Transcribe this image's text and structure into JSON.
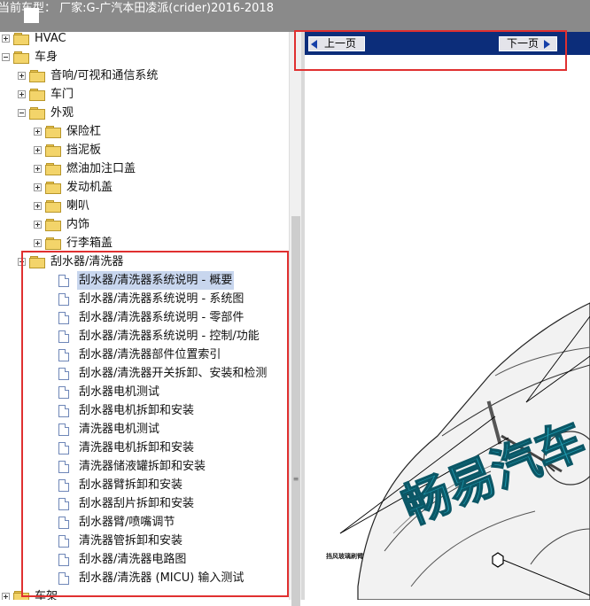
{
  "title_bar": {
    "text": "当前车型： 厂家:G-广汽本田凌派(crider)2016-2018"
  },
  "tree": {
    "nodes": [
      {
        "label": "HVAC",
        "type": "folder",
        "expander": "plus"
      },
      {
        "label": "车身",
        "type": "folder",
        "expander": "minus"
      },
      {
        "label": "音响/可视和通信系统",
        "type": "folder",
        "expander": "plus"
      },
      {
        "label": "车门",
        "type": "folder",
        "expander": "plus"
      },
      {
        "label": "外观",
        "type": "folder",
        "expander": "minus"
      },
      {
        "label": "保险杠",
        "type": "folder",
        "expander": "plus"
      },
      {
        "label": "挡泥板",
        "type": "folder",
        "expander": "plus"
      },
      {
        "label": "燃油加注口盖",
        "type": "folder",
        "expander": "plus"
      },
      {
        "label": "发动机盖",
        "type": "folder",
        "expander": "plus"
      },
      {
        "label": "喇叭",
        "type": "folder",
        "expander": "plus"
      },
      {
        "label": "内饰",
        "type": "folder",
        "expander": "plus"
      },
      {
        "label": "行李箱盖",
        "type": "folder",
        "expander": "plus"
      },
      {
        "label": "刮水器/清洗器",
        "type": "folder",
        "expander": "minus"
      },
      {
        "label": "刮水器/清洗器系统说明 - 概要",
        "type": "doc",
        "selected": true
      },
      {
        "label": "刮水器/清洗器系统说明 - 系统图",
        "type": "doc"
      },
      {
        "label": "刮水器/清洗器系统说明 - 零部件",
        "type": "doc"
      },
      {
        "label": "刮水器/清洗器系统说明 - 控制/功能",
        "type": "doc"
      },
      {
        "label": "刮水器/清洗器部件位置索引",
        "type": "doc"
      },
      {
        "label": "刮水器/清洗器开关拆卸、安装和检测",
        "type": "doc"
      },
      {
        "label": "刮水器电机测试",
        "type": "doc"
      },
      {
        "label": "刮水器电机拆卸和安装",
        "type": "doc"
      },
      {
        "label": "清洗器电机测试",
        "type": "doc"
      },
      {
        "label": "清洗器电机拆卸和安装",
        "type": "doc"
      },
      {
        "label": "清洗器储液罐拆卸和安装",
        "type": "doc"
      },
      {
        "label": "刮水器臂拆卸和安装",
        "type": "doc"
      },
      {
        "label": "刮水器刮片拆卸和安装",
        "type": "doc"
      },
      {
        "label": "刮水器臂/喷嘴调节",
        "type": "doc"
      },
      {
        "label": "清洗器管拆卸和安装",
        "type": "doc"
      },
      {
        "label": "刮水器/清洗器电路图",
        "type": "doc"
      },
      {
        "label": "刮水器/清洗器 (MICU) 输入测试",
        "type": "doc"
      },
      {
        "label": "车架",
        "type": "folder",
        "expander": "plus"
      }
    ]
  },
  "nav": {
    "prev_label": "上一页",
    "next_label": "下一页"
  },
  "diagram": {
    "watermark": "畅易汽车",
    "caption": "挡风玻璃刷臂"
  },
  "colors": {
    "navbar": "#0c2d7a",
    "highlight": "#e03030",
    "selection": "#c8d6ee",
    "titlebar": "#8a8a8a"
  }
}
